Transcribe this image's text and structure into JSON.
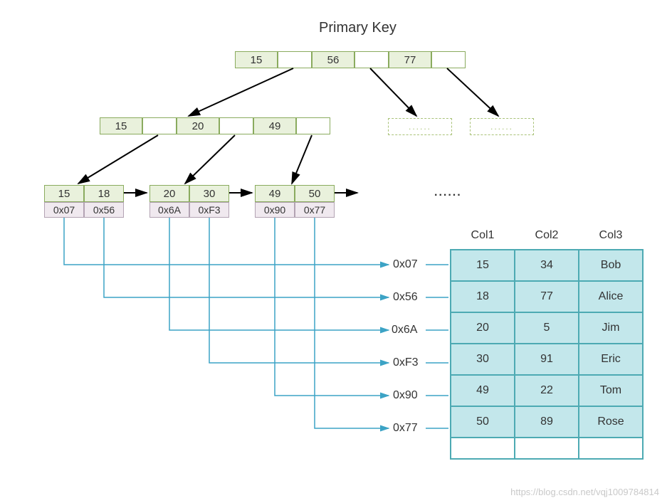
{
  "title": "Primary Key",
  "root": {
    "keys": [
      "15",
      "56",
      "77"
    ]
  },
  "mid": {
    "keys": [
      "15",
      "20",
      "49"
    ]
  },
  "dashEllipsis": "......",
  "leaves": [
    {
      "keys": [
        "15",
        "18"
      ],
      "vals": [
        "0x07",
        "0x56"
      ]
    },
    {
      "keys": [
        "20",
        "30"
      ],
      "vals": [
        "0x6A",
        "0xF3"
      ]
    },
    {
      "keys": [
        "49",
        "50"
      ],
      "vals": [
        "0x90",
        "0x77"
      ]
    }
  ],
  "leafEllipsis": "......",
  "addresses": [
    "0x07",
    "0x56",
    "0x6A",
    "0xF3",
    "0x90",
    "0x77"
  ],
  "table": {
    "headers": [
      "Col1",
      "Col2",
      "Col3"
    ],
    "rows": [
      [
        "15",
        "34",
        "Bob"
      ],
      [
        "18",
        "77",
        "Alice"
      ],
      [
        "20",
        "5",
        "Jim"
      ],
      [
        "30",
        "91",
        "Eric"
      ],
      [
        "49",
        "22",
        "Tom"
      ],
      [
        "50",
        "89",
        "Rose"
      ]
    ]
  },
  "watermark": "https://blog.csdn.net/vqj1009784814",
  "chart_data": {
    "type": "table",
    "title": "Primary Key B+Tree Index Diagram",
    "btree": {
      "root_keys": [
        15,
        56,
        77
      ],
      "internal_keys": [
        15,
        20,
        49
      ],
      "leaves": [
        {
          "keys": [
            15,
            18
          ],
          "pointers": [
            "0x07",
            "0x56"
          ]
        },
        {
          "keys": [
            20,
            30
          ],
          "pointers": [
            "0x6A",
            "0xF3"
          ]
        },
        {
          "keys": [
            49,
            50
          ],
          "pointers": [
            "0x90",
            "0x77"
          ]
        }
      ]
    },
    "records": {
      "0x07": {
        "Col1": 15,
        "Col2": 34,
        "Col3": "Bob"
      },
      "0x56": {
        "Col1": 18,
        "Col2": 77,
        "Col3": "Alice"
      },
      "0x6A": {
        "Col1": 20,
        "Col2": 5,
        "Col3": "Jim"
      },
      "0xF3": {
        "Col1": 30,
        "Col2": 91,
        "Col3": "Eric"
      },
      "0x90": {
        "Col1": 49,
        "Col2": 22,
        "Col3": "Tom"
      },
      "0x77": {
        "Col1": 50,
        "Col2": 89,
        "Col3": "Rose"
      }
    }
  }
}
